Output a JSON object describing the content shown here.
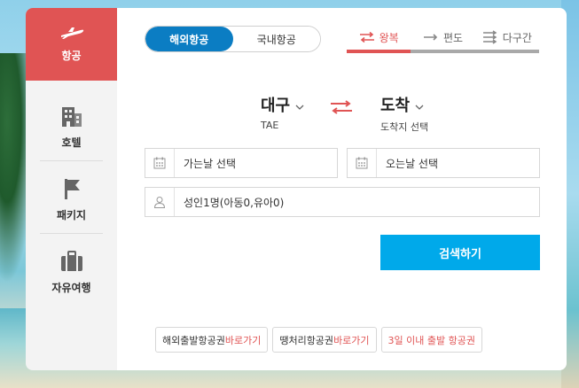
{
  "sidebar": {
    "items": [
      {
        "label": "항공",
        "icon": "airplane-icon",
        "active": true
      },
      {
        "label": "호텔",
        "icon": "hotel-building-icon",
        "active": false
      },
      {
        "label": "패키지",
        "icon": "flag-icon",
        "active": false
      },
      {
        "label": "자유여행",
        "icon": "suitcase-icon",
        "active": false
      }
    ]
  },
  "scope": {
    "international": "해외항공",
    "domestic": "국내항공",
    "selected": "해외항공"
  },
  "trip_type": {
    "round_trip": "왕복",
    "one_way": "편도",
    "multi_city": "다구간",
    "selected": "왕복"
  },
  "route": {
    "from_city": "대구",
    "from_code": "TAE",
    "to_city": "도착",
    "to_hint": "도착지 선택"
  },
  "dates": {
    "depart_placeholder": "가는날 선택",
    "return_placeholder": "오는날 선택"
  },
  "passengers": {
    "value": "성인1명(아동0,유아0)"
  },
  "search_label": "검색하기",
  "promos": {
    "p1_text": "해외출발항공권 ",
    "p1_link": "바로가기",
    "p2_text": "땡처리항공권 ",
    "p2_link": "바로가기",
    "p3_text": "3일 이내 출발 항공권"
  },
  "colors": {
    "accent_red": "#e05454",
    "primary_blue": "#0b7dc3",
    "search_blue": "#00a9ea"
  }
}
